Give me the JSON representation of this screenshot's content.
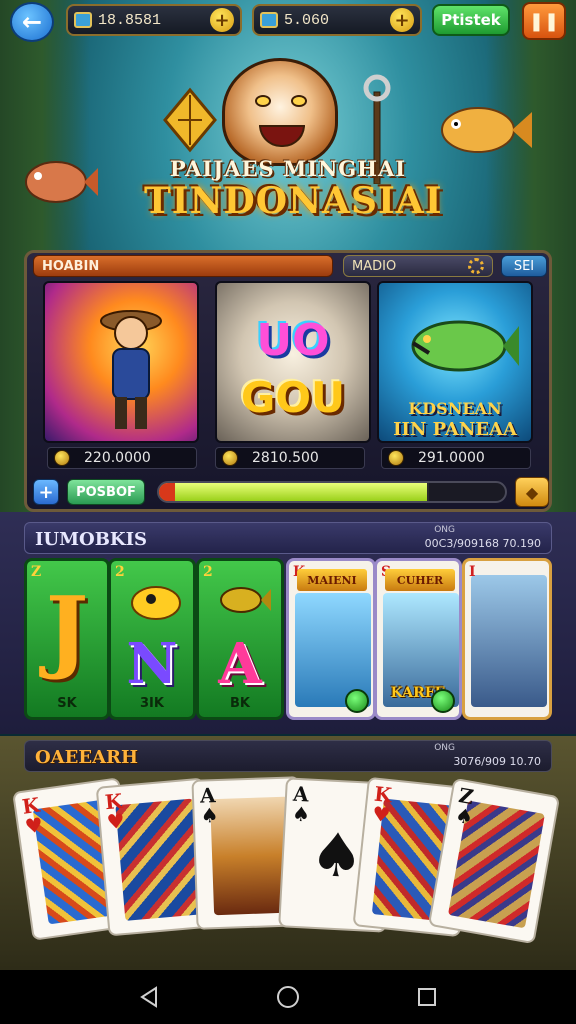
{
  "topbar": {
    "currency1": "18.8581",
    "currency2": "5.060",
    "green_button": "Ptistek",
    "icons": [
      "arrow-left-icon",
      "plus-icon",
      "pause-icon"
    ]
  },
  "hero": {
    "subtitle": "PAIJAES MINGHAI",
    "title": "TINDONASIAI"
  },
  "panel": {
    "tabs": [
      "HOABIN",
      "MADIO",
      "SEI"
    ],
    "games": [
      {
        "name": "hero-game",
        "payout": "220.0000"
      },
      {
        "name": "uo-gou",
        "line1": "UO",
        "line2": "GOU",
        "payout": "2810.500"
      },
      {
        "name": "fishing",
        "cap1": "KDSNEAN",
        "cap2": "IIN PANEAA",
        "payout": "291.0000"
      }
    ],
    "controls": {
      "pos_label": "POSBOF",
      "progress": 0.78
    }
  },
  "section1": {
    "title": "IUMOBKIS",
    "small": "ONG",
    "meta": "00C3/909168  70.190",
    "slots": [
      {
        "corner": "Z",
        "glyph": "J",
        "label": "SK",
        "color": "green"
      },
      {
        "corner": "2",
        "glyph": "N",
        "label": "3IK",
        "color": "green"
      },
      {
        "corner": "2",
        "glyph": "A",
        "label": "BK",
        "color": "green"
      },
      {
        "corner": "K",
        "banner": "MAIENI",
        "color": "white"
      },
      {
        "corner": "S",
        "banner": "CUHER",
        "caption": "KARFE",
        "color": "white"
      },
      {
        "corner": "I",
        "color": "white"
      }
    ]
  },
  "section2": {
    "title": "OAEEARH",
    "small": "ONG",
    "meta": "3076/909  10.70",
    "cards": [
      {
        "rank": "K",
        "suit": "♥",
        "color": "red"
      },
      {
        "rank": "K",
        "suit": "♥",
        "color": "red"
      },
      {
        "rank": "A",
        "suit": "♠",
        "color": "black"
      },
      {
        "rank": "A",
        "suit": "♠",
        "color": "black"
      },
      {
        "rank": "K",
        "suit": "♥",
        "color": "red"
      },
      {
        "rank": "Z",
        "suit": "♠",
        "color": "black"
      }
    ]
  },
  "colors": {
    "accent_gold": "#ffc734",
    "green_button": "#1e9b30",
    "orange_button": "#d8530f",
    "blue_button": "#1b6fd1"
  }
}
